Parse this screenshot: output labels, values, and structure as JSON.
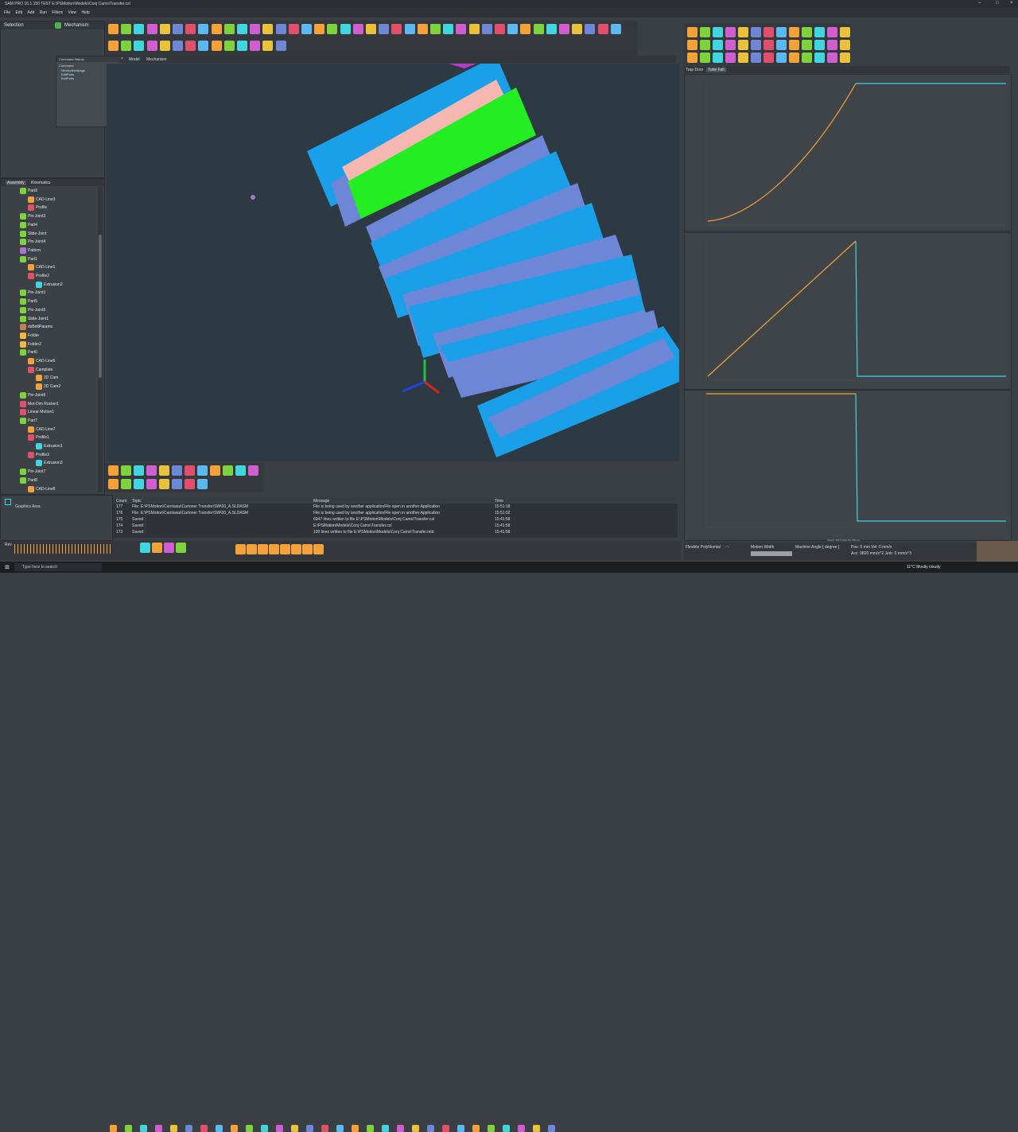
{
  "app": {
    "title": "SAM PRO 16.1.150  TEST  E:\\PSMotion\\Models\\Conj Cams\\Transfer.cxl",
    "menu": [
      "File",
      "Edit",
      "Add",
      "Run",
      "Filters",
      "View",
      "Help"
    ]
  },
  "left_panel": {
    "tabs": [
      "Selection",
      "Mechanism"
    ],
    "command_history": {
      "title": "Command History",
      "header": "Command",
      "items": [
        "NewIndirectpage",
        "EditParts",
        "EditParts"
      ]
    },
    "tree_tabs": [
      "Assembly",
      "Kinematics"
    ],
    "tree": [
      {
        "label": "Part3",
        "icon": "part-icon",
        "indent": 1
      },
      {
        "label": "CAD-Line3",
        "icon": "cad-line-icon",
        "indent": 2
      },
      {
        "label": "Profile",
        "icon": "profile-icon",
        "indent": 2
      },
      {
        "label": "Pin-Joint3",
        "icon": "pin-joint-icon",
        "indent": 1
      },
      {
        "label": "Part4",
        "icon": "part-icon",
        "indent": 1
      },
      {
        "label": "Slide-Joint",
        "icon": "slide-joint-icon",
        "indent": 1
      },
      {
        "label": "Pin-Joint4",
        "icon": "pin-joint-icon",
        "indent": 1
      },
      {
        "label": "Pattern",
        "icon": "pattern-icon",
        "indent": 1
      },
      {
        "label": "Part1",
        "icon": "part-icon",
        "indent": 1
      },
      {
        "label": "CAD-Line1",
        "icon": "cad-line-icon",
        "indent": 2
      },
      {
        "label": "Profile2",
        "icon": "profile-icon",
        "indent": 2
      },
      {
        "label": "Extrusion2",
        "icon": "extrusion-icon",
        "indent": 3
      },
      {
        "label": "Pin-Joint1",
        "icon": "pin-joint-icon",
        "indent": 1
      },
      {
        "label": "Part5",
        "icon": "part-icon",
        "indent": 1
      },
      {
        "label": "Pin-Joint5",
        "icon": "pin-joint-icon",
        "indent": 1
      },
      {
        "label": "Slide-Joint1",
        "icon": "slide-joint-icon",
        "indent": 1
      },
      {
        "label": "dsBeltParams",
        "icon": "params-icon",
        "indent": 1
      },
      {
        "label": "Folder",
        "icon": "folder-icon",
        "indent": 1
      },
      {
        "label": "Folder2",
        "icon": "folder-icon",
        "indent": 1
      },
      {
        "label": "Part6",
        "icon": "part-icon",
        "indent": 1
      },
      {
        "label": "CAD-Line6",
        "icon": "cad-line-icon",
        "indent": 2
      },
      {
        "label": "Camplate",
        "icon": "profile-icon",
        "indent": 2
      },
      {
        "label": "2D Cam",
        "icon": "cam-icon",
        "indent": 3
      },
      {
        "label": "2D Cam2",
        "icon": "cam-icon",
        "indent": 3
      },
      {
        "label": "Pin-Joint6",
        "icon": "pin-joint-icon",
        "indent": 1
      },
      {
        "label": "Mot-Dim Rocker1",
        "icon": "rocker-icon",
        "indent": 1
      },
      {
        "label": "Linear Motion1",
        "icon": "motion-icon",
        "indent": 1
      },
      {
        "label": "Part7",
        "icon": "part-icon",
        "indent": 1
      },
      {
        "label": "CAD-Line7",
        "icon": "cad-line-icon",
        "indent": 2
      },
      {
        "label": "Profile1",
        "icon": "profile-icon",
        "indent": 2
      },
      {
        "label": "Extrusion1",
        "icon": "extrusion-icon",
        "indent": 3
      },
      {
        "label": "Profile3",
        "icon": "profile-icon",
        "indent": 2
      },
      {
        "label": "Extrusion3",
        "icon": "extrusion-icon",
        "indent": 3
      },
      {
        "label": "Pin-Joint7",
        "icon": "pin-joint-icon",
        "indent": 1
      },
      {
        "label": "Part8",
        "icon": "part-icon",
        "indent": 1
      },
      {
        "label": "CAD-Line8",
        "icon": "cad-line-icon",
        "indent": 2
      }
    ]
  },
  "viewport": {
    "tabs": [
      "Model",
      "Mechanism"
    ]
  },
  "graphics_area": {
    "label": "Graphics Area"
  },
  "output": {
    "columns": [
      "Count",
      "Topic",
      "Message",
      "Time"
    ],
    "rows": [
      {
        "count": "177",
        "topic": "File: E:\\PSMotion\\Camtasia\\Cartoner Transfer\\SW\\00_A.SLDASM",
        "message": "File is being used by another applicationFile open in another Application",
        "time": "15:51:18"
      },
      {
        "count": "176",
        "topic": "File: E:\\PSMotion\\Camtasia\\Cartoner Transfer\\SW\\00_A.SLDASM",
        "message": "File is being used by another applicationFile open in another Application",
        "time": "15:51:02"
      },
      {
        "count": "175",
        "topic": "Saved :",
        "message": "6947 lines written to file E:\\PSMotion\\Models\\Conj Cams\\Transfer.cxl",
        "time": "15:41:58"
      },
      {
        "count": "174",
        "topic": "Saved :",
        "message": "E:\\PSMotion\\Models\\Conj Cams\\Transfer.cxl",
        "time": "15:41:58"
      },
      {
        "count": "173",
        "topic": "Saved :",
        "message": "100 lines written to file E:\\PSMotion\\Models\\Conj Cams\\Transfer.mtd",
        "time": "15:41:58"
      }
    ]
  },
  "motion": {
    "tabs": [
      "Trap Door",
      "Tube Fall"
    ],
    "active_tab": "Tube Fall",
    "graph_footer": "Speed: 180 Cycles Per Minute",
    "bottom_bar": {
      "motion_type": "Flexible PolyNomial",
      "motion_width_label": "Motion-Width",
      "machine_angle_label": "Machine Angle [ degree ]",
      "pos": "Pos: 0 mm  Vel: 0 mm/s",
      "acc": "Acc: 9820 mm/s^2  Jerk: 0 mm/s^3"
    }
  },
  "transport": {
    "rev_label": "Rev"
  },
  "taskbar": {
    "search_placeholder": "Type here to search",
    "weather": "11°C  Mostly cloudy"
  },
  "colors": {
    "accent_orange": "#f5a13a",
    "cyan_line": "#3fd6e0",
    "part_blue": "#1aa0e8",
    "part_lavender": "#6e86d6",
    "part_green": "#22ee22",
    "part_pink": "#f5b7b0"
  }
}
